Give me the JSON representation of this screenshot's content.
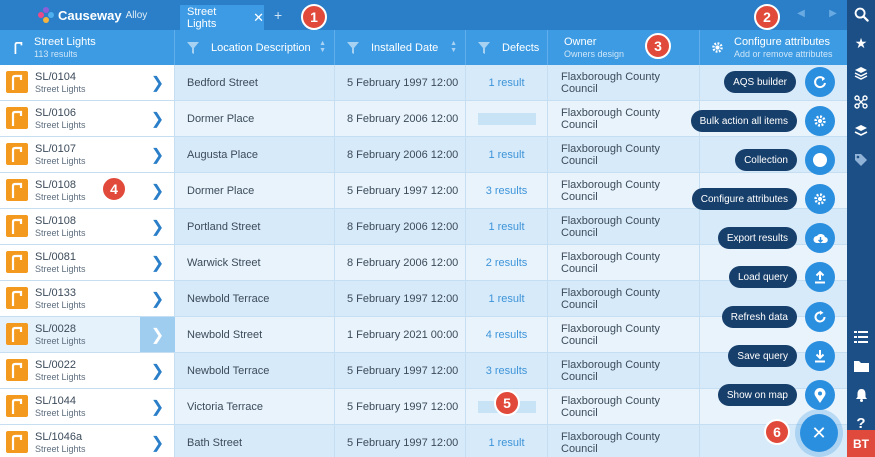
{
  "app": {
    "brand": "Causeway",
    "product": "Alloy"
  },
  "tabs": [
    {
      "label": "Street Lights"
    }
  ],
  "tab_add": "+",
  "header": {
    "first": {
      "title": "Street Lights",
      "count": "113 results"
    },
    "columns": [
      {
        "label": "Location Description"
      },
      {
        "label": "Installed Date"
      },
      {
        "label": "Defects"
      },
      {
        "label": "Owner",
        "sub": "Owners design"
      }
    ],
    "configure": {
      "title": "Configure attributes",
      "sub": "Add or remove attributes"
    }
  },
  "rows": [
    {
      "id": "SL/0104",
      "type": "Street Lights",
      "location": "Bedford Street",
      "installed": "5 February 1997 12:00",
      "defects": "1 result",
      "owner": "Flaxborough County Council"
    },
    {
      "id": "SL/0106",
      "type": "Street Lights",
      "location": "Dormer Place",
      "installed": "8 February 2006 12:00",
      "defects": "",
      "owner": "Flaxborough County Council"
    },
    {
      "id": "SL/0107",
      "type": "Street Lights",
      "location": "Augusta Place",
      "installed": "8 February 2006 12:00",
      "defects": "1 result",
      "owner": "Flaxborough County Council"
    },
    {
      "id": "SL/0108",
      "type": "Street Lights",
      "location": "Dormer Place",
      "installed": "5 February 1997 12:00",
      "defects": "3 results",
      "owner": "Flaxborough County Council"
    },
    {
      "id": "SL/0108",
      "type": "Street Lights",
      "location": "Portland Street",
      "installed": "8 February 2006 12:00",
      "defects": "1 result",
      "owner": "Flaxborough County Council"
    },
    {
      "id": "SL/0081",
      "type": "Street Lights",
      "location": "Warwick Street",
      "installed": "8 February 2006 12:00",
      "defects": "2 results",
      "owner": "Flaxborough County Council"
    },
    {
      "id": "SL/0133",
      "type": "Street Lights",
      "location": "Newbold Terrace",
      "installed": "5 February 1997 12:00",
      "defects": "1 result",
      "owner": "Flaxborough County Council"
    },
    {
      "id": "SL/0028",
      "type": "Street Lights",
      "location": "Newbold Street",
      "installed": "1 February 2021 00:00",
      "defects": "4 results",
      "owner": "Flaxborough County Council"
    },
    {
      "id": "SL/0022",
      "type": "Street Lights",
      "location": "Newbold Terrace",
      "installed": "5 February 1997 12:00",
      "defects": "3 results",
      "owner": "Flaxborough County Council"
    },
    {
      "id": "SL/1044",
      "type": "Street Lights",
      "location": "Victoria Terrace",
      "installed": "5 February 1997 12:00",
      "defects": "",
      "owner": "Flaxborough County Council"
    },
    {
      "id": "SL/1046a",
      "type": "Street Lights",
      "location": "Bath Street",
      "installed": "5 February 1997 12:00",
      "defects": "1 result",
      "owner": "Flaxborough County Council"
    }
  ],
  "selected_row_id": "SL/0028",
  "fab_menu": [
    {
      "label": "AQS builder",
      "icon": "refresh-cycle-icon"
    },
    {
      "label": "Bulk action all items",
      "icon": "gear-icon"
    },
    {
      "label": "Collection",
      "icon": "circle-icon"
    },
    {
      "label": "Configure attributes",
      "icon": "gear-icon"
    },
    {
      "label": "Export results",
      "icon": "cloud-download-icon"
    },
    {
      "label": "Load query",
      "icon": "upload-icon"
    },
    {
      "label": "Refresh data",
      "icon": "refresh-icon"
    },
    {
      "label": "Save query",
      "icon": "download-icon"
    },
    {
      "label": "Show on map",
      "icon": "map-pin-icon"
    }
  ],
  "callouts": [
    "1",
    "2",
    "3",
    "4",
    "5",
    "6"
  ],
  "user_initials": "BT",
  "colors": {
    "topbar": "#2a7fc8",
    "header": "#3c9be3",
    "rail": "#1c4f86",
    "asset": "#f39a1e",
    "fab": "#2b8fe0",
    "callout": "#e14a3a"
  }
}
